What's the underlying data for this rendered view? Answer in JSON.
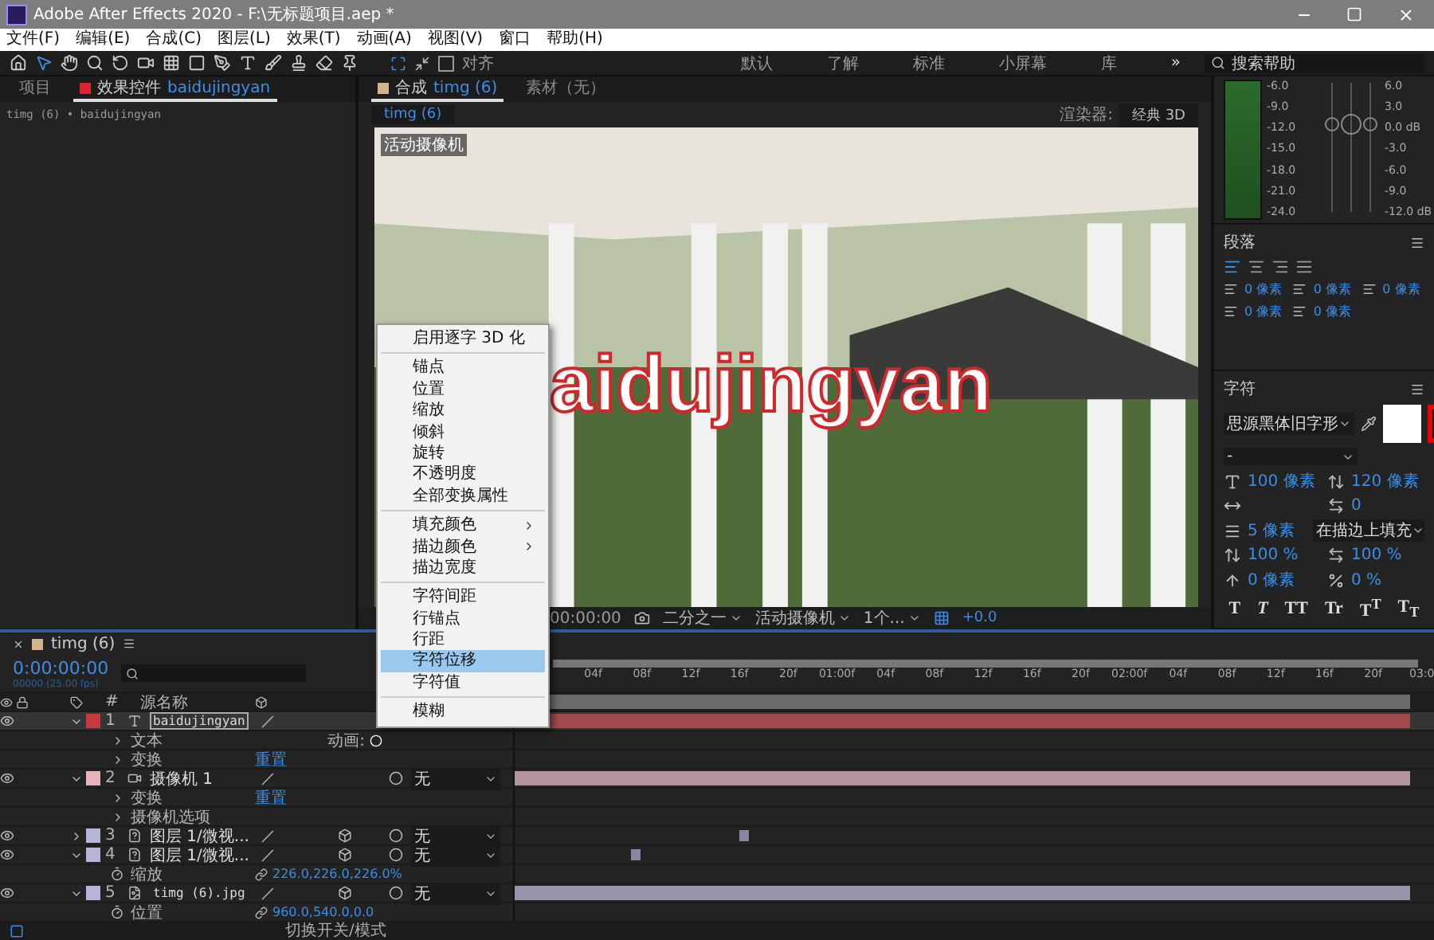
{
  "window": {
    "title": "Adobe After Effects 2020 - F:\\无标题项目.aep *"
  },
  "menu": [
    "文件(F)",
    "编辑(E)",
    "合成(C)",
    "图层(L)",
    "效果(T)",
    "动画(A)",
    "视图(V)",
    "窗口",
    "帮助(H)"
  ],
  "toolbar": {
    "align_label": "对齐",
    "align_checked": false,
    "workspaces": [
      "默认",
      "了解",
      "标准",
      "小屏幕",
      "库"
    ],
    "more": "»",
    "search": {
      "placeholder": "搜索帮助"
    }
  },
  "left_panel": {
    "tabs": [
      {
        "label": "项目",
        "selected": false
      },
      {
        "label": "效果控件",
        "target": "baidujingyan",
        "selected": true
      }
    ],
    "breadcrumb": "timg (6) • baidujingyan"
  },
  "comp_panel": {
    "tabs": [
      {
        "label": "合成",
        "target": "timg (6)",
        "selected": true
      },
      {
        "label": "素材（无）",
        "selected": false
      }
    ],
    "comp_tab": "timg (6)",
    "renderer_label": "渲染器:",
    "renderer": "经典 3D",
    "viewer_label": "活动摄像机",
    "layer_text": "aidujingyan",
    "footer": {
      "time": "00:00:00",
      "zoom": "二分之一",
      "camera": "活动摄像机",
      "views": "1个...",
      "exposure": "+0.0"
    }
  },
  "audio": {
    "left_ticks": [
      "-6.0",
      "-9.0",
      "-12.0",
      "-15.0",
      "-18.0",
      "-21.0",
      "-24.0"
    ],
    "right_ticks": [
      "6.0",
      "3.0",
      "0.0 dB",
      "-3.0",
      "-6.0",
      "-9.0",
      "-12.0 dB"
    ]
  },
  "paragraph": {
    "title": "段落",
    "indents": [
      "0 像素",
      "0 像素",
      "0 像素",
      "0 像素",
      "0 像素"
    ]
  },
  "character": {
    "title": "字符",
    "font": "思源黑体旧字形",
    "style": "-",
    "fields": [
      {
        "kind": "size",
        "value": "100 像素"
      },
      {
        "kind": "leading",
        "value": "120 像素"
      },
      {
        "kind": "kerning"
      },
      {
        "kind": "tracking",
        "value": "0"
      }
    ],
    "stroke_width": "5 像素",
    "stroke_mode": "在描边上填充",
    "scale_fields": [
      {
        "kind": "vscale",
        "value": "100 %"
      },
      {
        "kind": "hscale",
        "value": "100 %"
      },
      {
        "kind": "baseline",
        "value": "0 像素"
      },
      {
        "kind": "tsume",
        "value": "0 %"
      }
    ],
    "style_buttons": [
      "T",
      "*T*",
      "TT",
      "Tr",
      "T$^{T}$",
      "T$_{T}$"
    ]
  },
  "timeline": {
    "tab": "timg (6)",
    "timecode": "0:00:00:00",
    "frame_info": "00000 (25.00 fps)",
    "number_header": "#",
    "name_header": "源名称",
    "ruler": [
      "04f",
      "08f",
      "12f",
      "16f",
      "20f",
      "01:00f",
      "04f",
      "08f",
      "12f",
      "16f",
      "20f",
      "02:00f",
      "04f",
      "08f",
      "12f",
      "16f",
      "20f",
      "03:0"
    ],
    "layers": [
      {
        "number": "1",
        "kind": "text",
        "name": "baidujingyan",
        "color": "#c9383a",
        "selected": true,
        "expanded": true,
        "track": {
          "kind": "bar"
        },
        "children": [
          {
            "label": "文本",
            "extra": "动画:"
          },
          {
            "label": "变换",
            "link": "重置"
          }
        ]
      },
      {
        "number": "2",
        "kind": "camera",
        "name": "摄像机 1",
        "color": "#e6b3bd",
        "selected": false,
        "expanded": true,
        "parent": "无",
        "track": {
          "kind": "bar"
        },
        "children": [
          {
            "label": "变换",
            "link": "重置"
          },
          {
            "label": "摄像机选项"
          }
        ]
      },
      {
        "number": "3",
        "kind": "footage",
        "name": "图层 1/微视...",
        "color": "#b7b5d8",
        "selected": false,
        "expanded": false,
        "parent": "无",
        "track": {
          "kind": "marker"
        }
      },
      {
        "number": "4",
        "kind": "footage",
        "name": "图层 1/微视...",
        "color": "#b7b5d8",
        "selected": false,
        "expanded": true,
        "parent": "无",
        "track": {
          "kind": "early-marker"
        },
        "children": [
          {
            "label": "缩放",
            "value": "226.0,226.0,226.0%"
          }
        ]
      },
      {
        "number": "5",
        "kind": "image",
        "name": "timg (6).jpg",
        "color": "#b7b5d8",
        "selected": false,
        "expanded": true,
        "parent": "无",
        "track": {
          "kind": "bar"
        },
        "children": [
          {
            "label": "位置",
            "value": "960.0,540.0,0.0"
          }
        ]
      }
    ],
    "footer": "切换开关/模式"
  },
  "context_menu": {
    "groups": [
      [
        {
          "label": "启用逐字 3D 化",
          "selected": false,
          "submenu": false
        }
      ],
      [
        {
          "label": "锚点",
          "selected": false,
          "submenu": false
        },
        {
          "label": "位置",
          "selected": false,
          "submenu": false
        },
        {
          "label": "缩放",
          "selected": false,
          "submenu": false
        },
        {
          "label": "倾斜",
          "selected": false,
          "submenu": false
        },
        {
          "label": "旋转",
          "selected": false,
          "submenu": false
        },
        {
          "label": "不透明度",
          "selected": false,
          "submenu": false
        },
        {
          "label": "全部变换属性",
          "selected": false,
          "submenu": false
        }
      ],
      [
        {
          "label": "填充颜色",
          "selected": false,
          "submenu": true
        },
        {
          "label": "描边颜色",
          "selected": false,
          "submenu": true
        },
        {
          "label": "描边宽度",
          "selected": false,
          "submenu": false
        }
      ],
      [
        {
          "label": "字符间距",
          "selected": false,
          "submenu": false
        },
        {
          "label": "行锚点",
          "selected": false,
          "submenu": false
        },
        {
          "label": "行距",
          "selected": false,
          "submenu": false
        },
        {
          "label": "字符位移",
          "selected": true,
          "submenu": false
        },
        {
          "label": "字符值",
          "selected": false,
          "submenu": false
        }
      ],
      [
        {
          "label": "模糊",
          "selected": false,
          "submenu": false
        }
      ]
    ]
  }
}
